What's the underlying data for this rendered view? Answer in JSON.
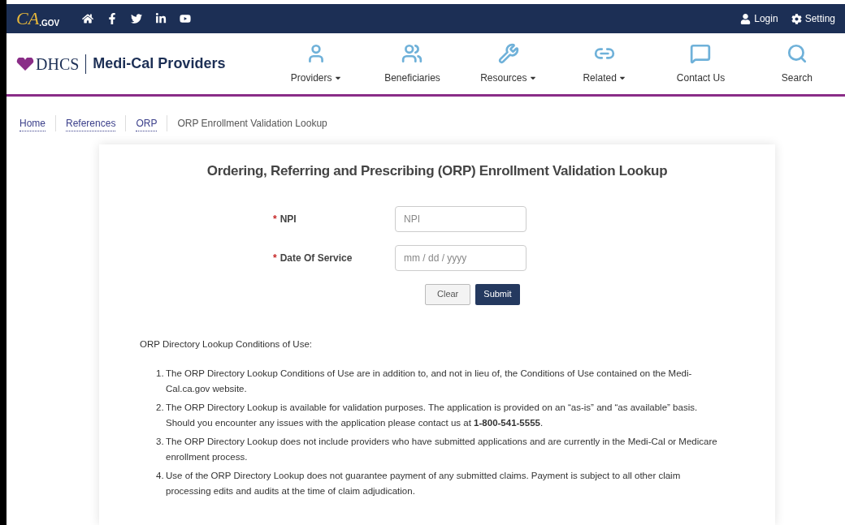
{
  "top_bar": {
    "logo": {
      "main": "CA",
      "sub": ".GOV"
    },
    "social": [
      {
        "kind": "home"
      },
      {
        "kind": "facebook"
      },
      {
        "kind": "twitter"
      },
      {
        "kind": "linkedin"
      },
      {
        "kind": "youtube"
      }
    ],
    "links": [
      {
        "kind": "user",
        "label": "Login"
      },
      {
        "kind": "gear",
        "label": "Setting"
      }
    ]
  },
  "header": {
    "brand": "DHCS",
    "site_title": "Medi-Cal Providers",
    "nav": [
      {
        "kind": "person",
        "label": "Providers",
        "dropdown": true
      },
      {
        "kind": "people",
        "label": "Beneficiaries",
        "dropdown": false
      },
      {
        "kind": "tools",
        "label": "Resources",
        "dropdown": true
      },
      {
        "kind": "link",
        "label": "Related",
        "dropdown": true
      },
      {
        "kind": "message",
        "label": "Contact Us",
        "dropdown": false
      },
      {
        "kind": "search",
        "label": "Search",
        "dropdown": false
      }
    ]
  },
  "breadcrumb": [
    {
      "label": "Home",
      "link": true
    },
    {
      "label": "References",
      "link": true
    },
    {
      "label": "ORP",
      "link": true
    },
    {
      "label": "ORP Enrollment Validation Lookup",
      "link": false
    }
  ],
  "form": {
    "title": "Ordering, Referring and Prescribing (ORP) Enrollment Validation Lookup",
    "fields": [
      {
        "required_mark": "*",
        "label": "NPI",
        "placeholder": "NPI"
      },
      {
        "required_mark": "*",
        "label": "Date Of Service",
        "placeholder": "mm / dd / yyyy"
      }
    ],
    "buttons": [
      {
        "kind": "secondary",
        "label": "Clear"
      },
      {
        "kind": "primary",
        "label": "Submit"
      }
    ]
  },
  "conditions": {
    "heading": "ORP Directory Lookup Conditions of Use:",
    "items": [
      {
        "number": "1.",
        "text": "The ORP Directory Lookup Conditions of Use are in addition to, and not in lieu of, the Conditions of Use contained on the Medi-Cal.ca.gov website."
      },
      {
        "number": "2.",
        "text": "The ORP Directory Lookup is available for validation purposes. The application is provided on an “as-is” and “as available” basis. Should you encounter any issues with the application please contact us at **1-800-541-5555**."
      },
      {
        "number": "3.",
        "text": "The ORP Directory Lookup does not include providers who have submitted applications and are currently in the Medi-Cal or Medicare enrollment process."
      },
      {
        "number": "4.",
        "text": "Use of the ORP Directory Lookup does not guarantee payment of any submitted claims. Payment is subject to all other claim processing edits and audits at the time of claim adjudication."
      }
    ]
  }
}
